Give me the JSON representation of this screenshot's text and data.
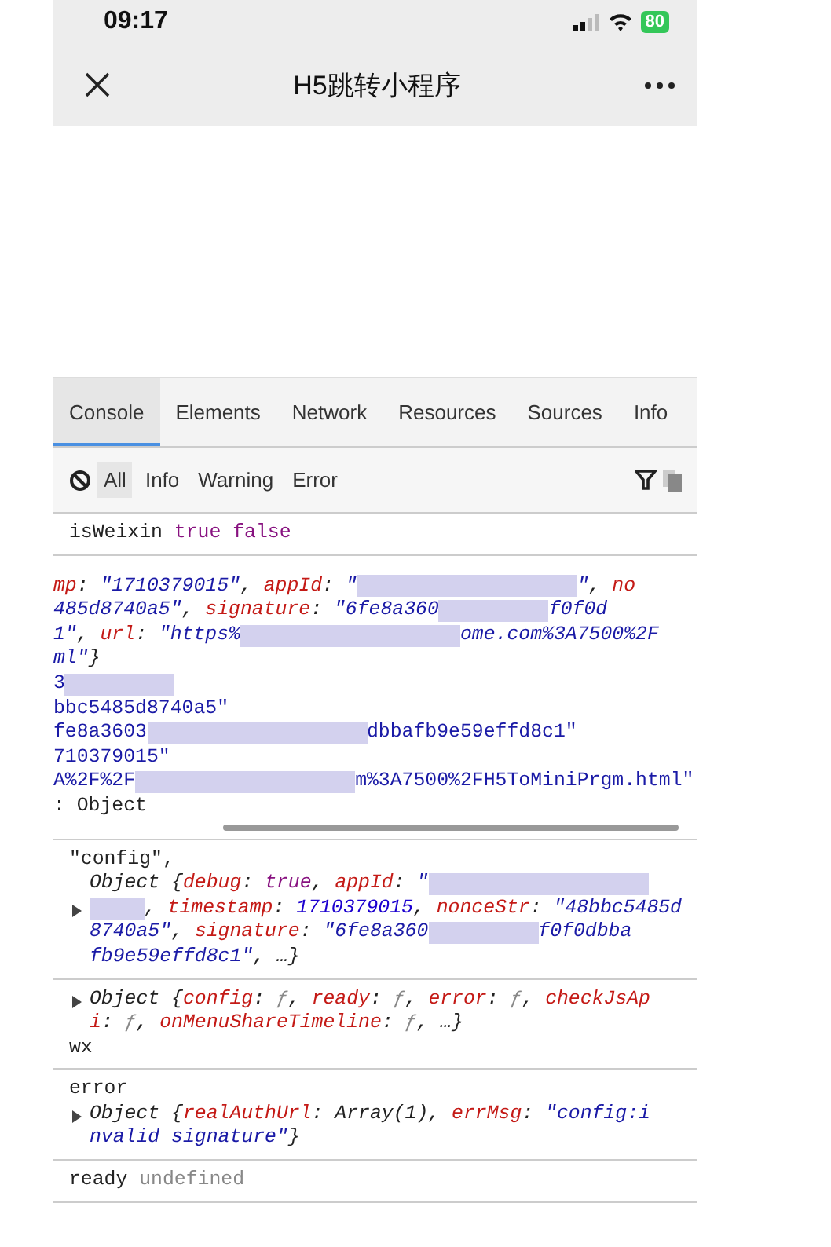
{
  "status_bar": {
    "time": "09:17",
    "battery": "80"
  },
  "nav": {
    "title": "H5跳转小程序"
  },
  "devtools": {
    "tabs": [
      {
        "label": "Console",
        "selected": true
      },
      {
        "label": "Elements",
        "selected": false
      },
      {
        "label": "Network",
        "selected": false
      },
      {
        "label": "Resources",
        "selected": false
      },
      {
        "label": "Sources",
        "selected": false
      },
      {
        "label": "Info",
        "selected": false
      }
    ],
    "filters": [
      {
        "label": "All",
        "selected": true
      },
      {
        "label": "Info",
        "selected": false
      },
      {
        "label": "Warning",
        "selected": false
      },
      {
        "label": "Error",
        "selected": false
      }
    ],
    "entries": [
      {
        "kind": "plain",
        "lines": [
          {
            "expander": false,
            "indented": false,
            "italic": false,
            "segments": [
              {
                "kind": "plain",
                "text": "isWeixin"
              },
              {
                "kind": "keyword",
                "text": " true false"
              }
            ]
          }
        ]
      },
      {
        "kind": "scrolled",
        "lines": [
          {
            "expander": false,
            "indented": false,
            "italic": true,
            "segments": [
              {
                "kind": "key",
                "text": "mp"
              },
              {
                "kind": "plain",
                "text": ": "
              },
              {
                "kind": "string",
                "text": "\"1710379015\""
              },
              {
                "kind": "plain",
                "text": ", "
              },
              {
                "kind": "key",
                "text": "appId"
              },
              {
                "kind": "plain",
                "text": ": "
              },
              {
                "kind": "string",
                "text": "\""
              },
              {
                "kind": "redacted"
              },
              {
                "kind": "redacted"
              },
              {
                "kind": "string",
                "text": "\""
              },
              {
                "kind": "plain",
                "text": ", "
              },
              {
                "kind": "key",
                "text": "no"
              }
            ]
          },
          {
            "expander": false,
            "indented": false,
            "italic": true,
            "segments": [
              {
                "kind": "string",
                "text": "485d8740a5\""
              },
              {
                "kind": "plain",
                "text": ", "
              },
              {
                "kind": "key",
                "text": "signature"
              },
              {
                "kind": "plain",
                "text": ": "
              },
              {
                "kind": "string",
                "text": "\"6fe8a360"
              },
              {
                "kind": "redacted"
              },
              {
                "kind": "string",
                "text": "f0f0d"
              }
            ]
          },
          {
            "expander": false,
            "indented": false,
            "italic": true,
            "segments": [
              {
                "kind": "string",
                "text": "1\""
              },
              {
                "kind": "plain",
                "text": ", "
              },
              {
                "kind": "key",
                "text": "url"
              },
              {
                "kind": "plain",
                "text": ": "
              },
              {
                "kind": "string",
                "text": "\"https%"
              },
              {
                "kind": "redacted"
              },
              {
                "kind": "redacted"
              },
              {
                "kind": "string",
                "text": "ome.com%3A7500%2F"
              }
            ]
          },
          {
            "expander": false,
            "indented": false,
            "italic": true,
            "segments": [
              {
                "kind": "string",
                "text": "ml\""
              },
              {
                "kind": "plain",
                "text": "}"
              }
            ]
          },
          {
            "expander": false,
            "indented": false,
            "italic": false,
            "segments": [
              {
                "kind": "string",
                "text": "3"
              },
              {
                "kind": "redacted"
              }
            ]
          },
          {
            "expander": false,
            "indented": false,
            "italic": false,
            "segments": [
              {
                "kind": "string",
                "text": "bbc5485d8740a5\""
              }
            ]
          },
          {
            "expander": false,
            "indented": false,
            "italic": false,
            "segments": [
              {
                "kind": "string",
                "text": "fe8a3603"
              },
              {
                "kind": "redacted"
              },
              {
                "kind": "redacted"
              },
              {
                "kind": "string",
                "text": "dbbafb9e59effd8c1\""
              }
            ]
          },
          {
            "expander": false,
            "indented": false,
            "italic": false,
            "segments": [
              {
                "kind": "string",
                "text": "710379015\""
              }
            ]
          },
          {
            "expander": false,
            "indented": false,
            "italic": false,
            "segments": [
              {
                "kind": "string",
                "text": "A%2F%2F"
              },
              {
                "kind": "redacted"
              },
              {
                "kind": "redacted"
              },
              {
                "kind": "string",
                "text": "m%3A7500%2FH5ToMiniPrgm.html\""
              }
            ]
          },
          {
            "expander": false,
            "indented": false,
            "italic": false,
            "segments": [
              {
                "kind": "plain",
                "text": ": Object"
              }
            ]
          }
        ]
      },
      {
        "kind": "plain",
        "lines": [
          {
            "expander": false,
            "indented": false,
            "italic": false,
            "segments": [
              {
                "kind": "plain",
                "text": "\"config\","
              }
            ]
          },
          {
            "expander": false,
            "indented": true,
            "italic": true,
            "segments": [
              {
                "kind": "plain",
                "text": "Object {"
              },
              {
                "kind": "key",
                "text": "debug"
              },
              {
                "kind": "plain",
                "text": ": "
              },
              {
                "kind": "keyword",
                "text": "true"
              },
              {
                "kind": "plain",
                "text": ", "
              },
              {
                "kind": "key",
                "text": "appId"
              },
              {
                "kind": "plain",
                "text": ": "
              },
              {
                "kind": "string",
                "text": "\""
              },
              {
                "kind": "redacted"
              },
              {
                "kind": "redacted"
              }
            ]
          },
          {
            "expander": true,
            "indented": true,
            "italic": true,
            "segments": [
              {
                "kind": "redacted"
              },
              {
                "kind": "plain",
                "text": ", "
              },
              {
                "kind": "key",
                "text": "timestamp"
              },
              {
                "kind": "plain",
                "text": ": "
              },
              {
                "kind": "number",
                "text": "1710379015"
              },
              {
                "kind": "plain",
                "text": ", "
              },
              {
                "kind": "key",
                "text": "nonceStr"
              },
              {
                "kind": "plain",
                "text": ": "
              },
              {
                "kind": "string",
                "text": "\"48bbc5485d"
              }
            ]
          },
          {
            "expander": false,
            "indented": true,
            "italic": true,
            "segments": [
              {
                "kind": "string",
                "text": "8740a5\""
              },
              {
                "kind": "plain",
                "text": ", "
              },
              {
                "kind": "key",
                "text": "signature"
              },
              {
                "kind": "plain",
                "text": ": "
              },
              {
                "kind": "string",
                "text": "\"6fe8a360"
              },
              {
                "kind": "redacted"
              },
              {
                "kind": "string",
                "text": "f0f0dbba"
              }
            ]
          },
          {
            "expander": false,
            "indented": true,
            "italic": true,
            "segments": [
              {
                "kind": "string",
                "text": "fb9e59effd8c1\""
              },
              {
                "kind": "plain",
                "text": ", …}"
              }
            ]
          }
        ]
      },
      {
        "kind": "plain",
        "lines": [
          {
            "expander": true,
            "indented": true,
            "italic": true,
            "segments": [
              {
                "kind": "plain",
                "text": "Object {"
              },
              {
                "kind": "key",
                "text": "config"
              },
              {
                "kind": "plain",
                "text": ": "
              },
              {
                "kind": "muted",
                "text": "ƒ"
              },
              {
                "kind": "plain",
                "text": ", "
              },
              {
                "kind": "key",
                "text": "ready"
              },
              {
                "kind": "plain",
                "text": ": "
              },
              {
                "kind": "muted",
                "text": "ƒ"
              },
              {
                "kind": "plain",
                "text": ", "
              },
              {
                "kind": "key",
                "text": "error"
              },
              {
                "kind": "plain",
                "text": ": "
              },
              {
                "kind": "muted",
                "text": "ƒ"
              },
              {
                "kind": "plain",
                "text": ", "
              },
              {
                "kind": "key",
                "text": "checkJsAp"
              }
            ]
          },
          {
            "expander": false,
            "indented": true,
            "italic": true,
            "segments": [
              {
                "kind": "key",
                "text": "i"
              },
              {
                "kind": "plain",
                "text": ": "
              },
              {
                "kind": "muted",
                "text": "ƒ"
              },
              {
                "kind": "plain",
                "text": ", "
              },
              {
                "kind": "key",
                "text": "onMenuShareTimeline"
              },
              {
                "kind": "plain",
                "text": ": "
              },
              {
                "kind": "muted",
                "text": "ƒ"
              },
              {
                "kind": "plain",
                "text": ", …}"
              }
            ]
          },
          {
            "expander": false,
            "indented": false,
            "italic": false,
            "segments": [
              {
                "kind": "plain",
                "text": "wx"
              }
            ]
          }
        ]
      },
      {
        "kind": "plain",
        "lines": [
          {
            "expander": false,
            "indented": false,
            "italic": false,
            "segments": [
              {
                "kind": "plain",
                "text": "error"
              }
            ]
          },
          {
            "expander": true,
            "indented": true,
            "italic": true,
            "segments": [
              {
                "kind": "plain",
                "text": "Object {"
              },
              {
                "kind": "key",
                "text": "realAuthUrl"
              },
              {
                "kind": "plain",
                "text": ": Array(1), "
              },
              {
                "kind": "key",
                "text": "errMsg"
              },
              {
                "kind": "plain",
                "text": ": "
              },
              {
                "kind": "string",
                "text": "\"config:i"
              }
            ]
          },
          {
            "expander": false,
            "indented": true,
            "italic": true,
            "segments": [
              {
                "kind": "string",
                "text": "nvalid signature\""
              },
              {
                "kind": "plain",
                "text": "}"
              }
            ]
          }
        ]
      },
      {
        "kind": "plain",
        "lines": [
          {
            "expander": false,
            "indented": false,
            "italic": false,
            "segments": [
              {
                "kind": "plain",
                "text": "ready"
              },
              {
                "kind": "muted",
                "text": " undefined"
              }
            ]
          }
        ]
      }
    ]
  }
}
